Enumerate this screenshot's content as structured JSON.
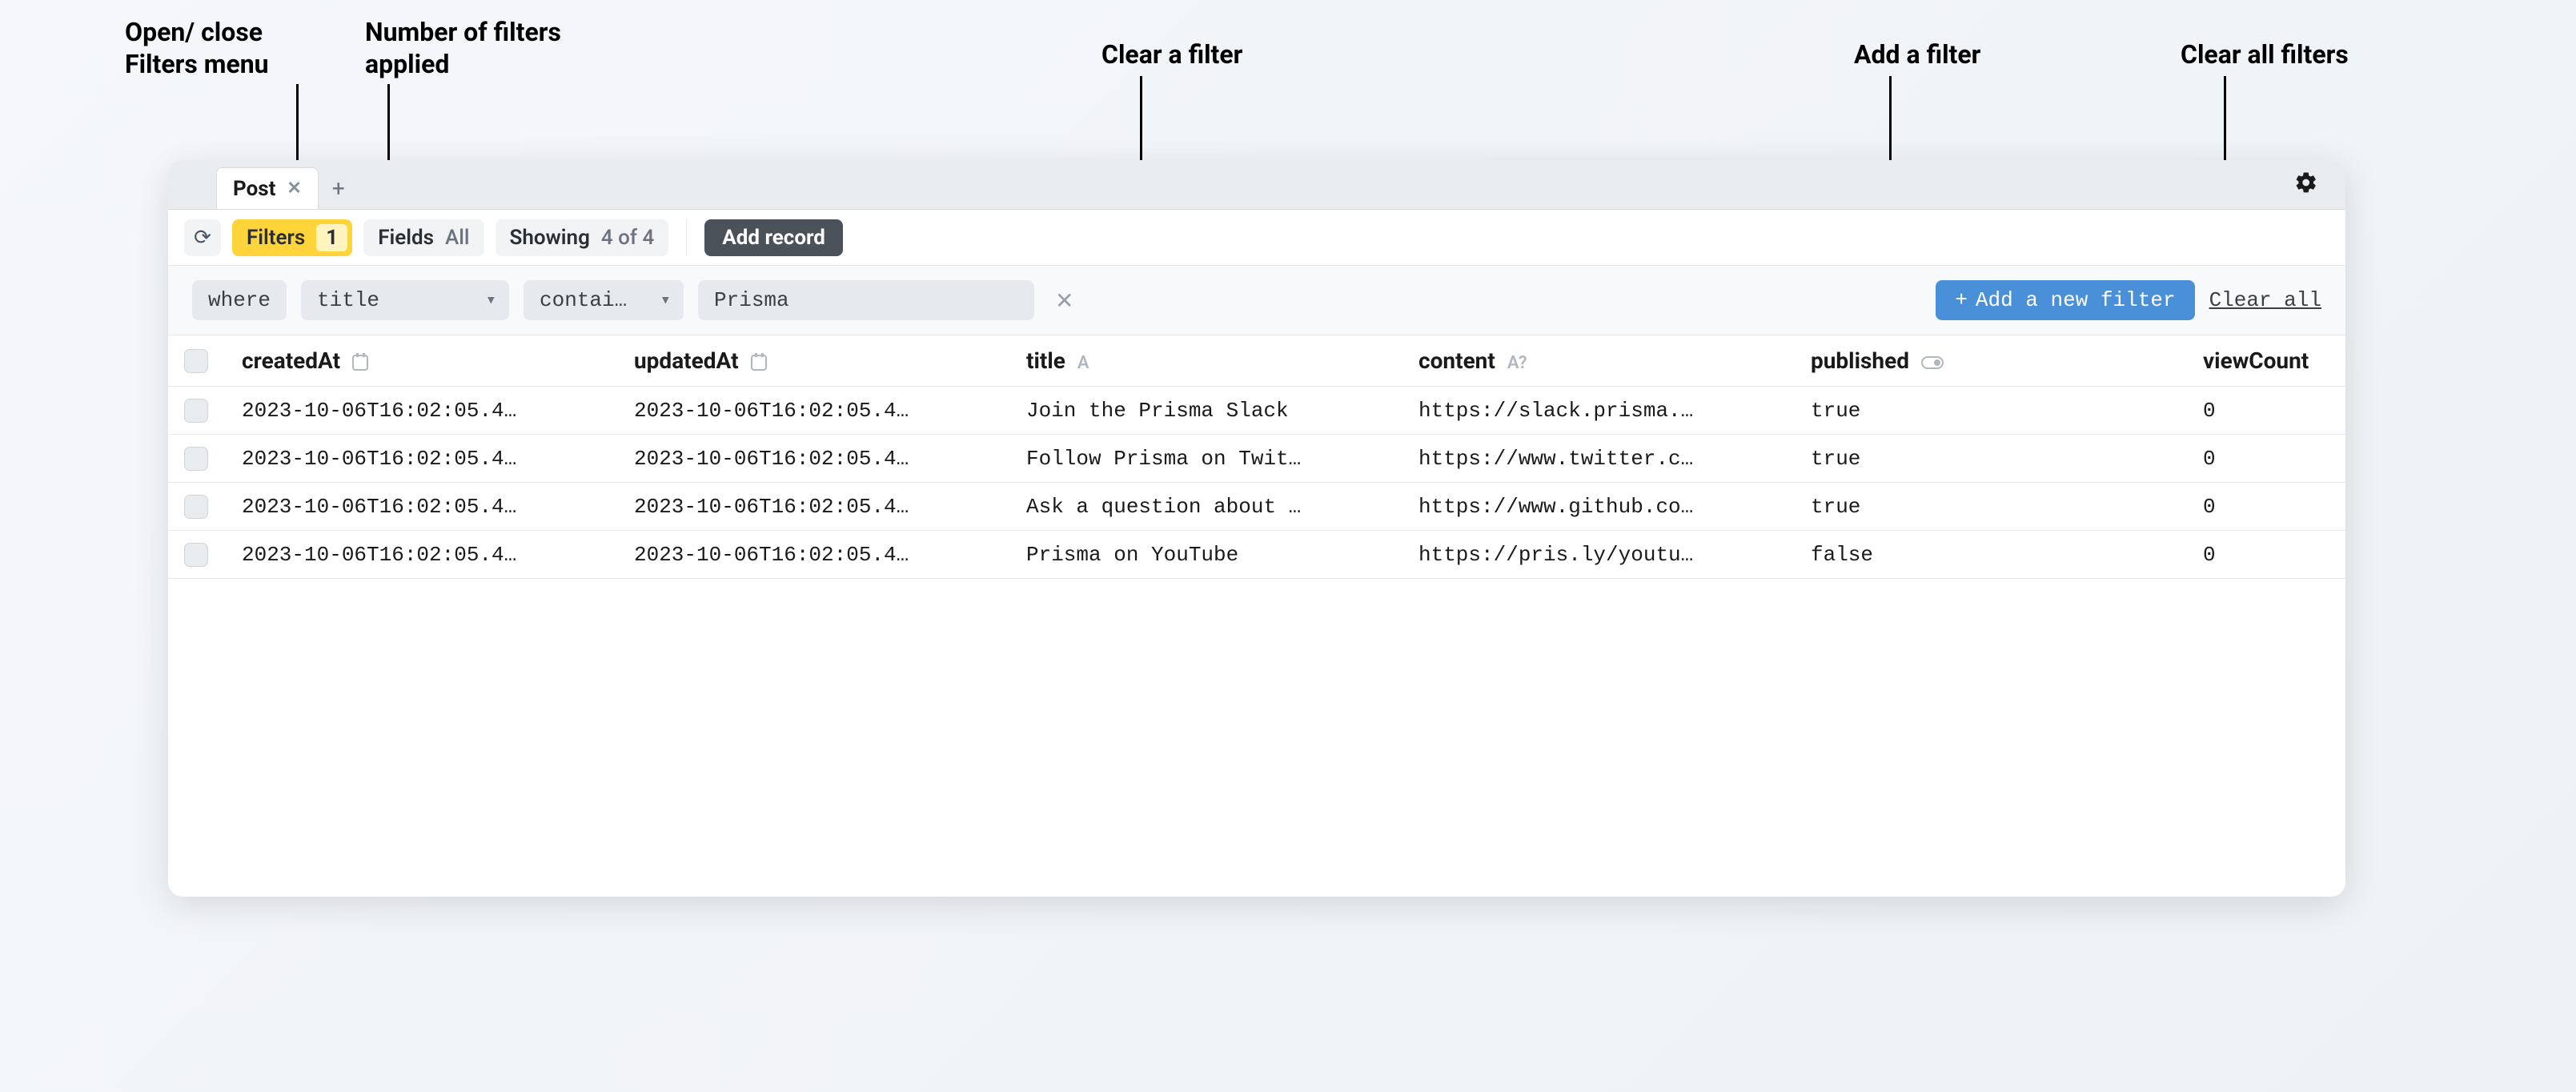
{
  "annotations": {
    "open_close": "Open/ close\nFilters menu",
    "num_filters": "Number of filters\napplied",
    "clear_filter": "Clear a filter",
    "add_filter": "Add a filter",
    "clear_all": "Clear all filters"
  },
  "tab": {
    "name": "Post"
  },
  "toolbar": {
    "filters_label": "Filters",
    "filters_count": "1",
    "fields_label": "Fields",
    "fields_value": "All",
    "showing_label": "Showing",
    "showing_value": "4 of 4",
    "add_record": "Add record"
  },
  "filter": {
    "where": "where",
    "field": "title",
    "op": "contai…",
    "value": "Prisma",
    "add_label": "Add a new filter",
    "clear_all": "Clear all"
  },
  "columns": {
    "createdAt": "createdAt",
    "updatedAt": "updatedAt",
    "title": "title",
    "content": "content",
    "published": "published",
    "viewCount": "viewCount"
  },
  "type_icons": {
    "string": "A",
    "nullable_string": "A?"
  },
  "rows": [
    {
      "createdAt": "2023-10-06T16:02:05.4…",
      "updatedAt": "2023-10-06T16:02:05.4…",
      "title": "Join the Prisma Slack",
      "content": "https://slack.prisma.…",
      "published": "true",
      "viewCount": "0"
    },
    {
      "createdAt": "2023-10-06T16:02:05.4…",
      "updatedAt": "2023-10-06T16:02:05.4…",
      "title": "Follow Prisma on Twit…",
      "content": "https://www.twitter.c…",
      "published": "true",
      "viewCount": "0"
    },
    {
      "createdAt": "2023-10-06T16:02:05.4…",
      "updatedAt": "2023-10-06T16:02:05.4…",
      "title": "Ask a question about …",
      "content": "https://www.github.co…",
      "published": "true",
      "viewCount": "0"
    },
    {
      "createdAt": "2023-10-06T16:02:05.4…",
      "updatedAt": "2023-10-06T16:02:05.4…",
      "title": "Prisma on YouTube",
      "content": "https://pris.ly/youtu…",
      "published": "false",
      "viewCount": "0"
    }
  ]
}
